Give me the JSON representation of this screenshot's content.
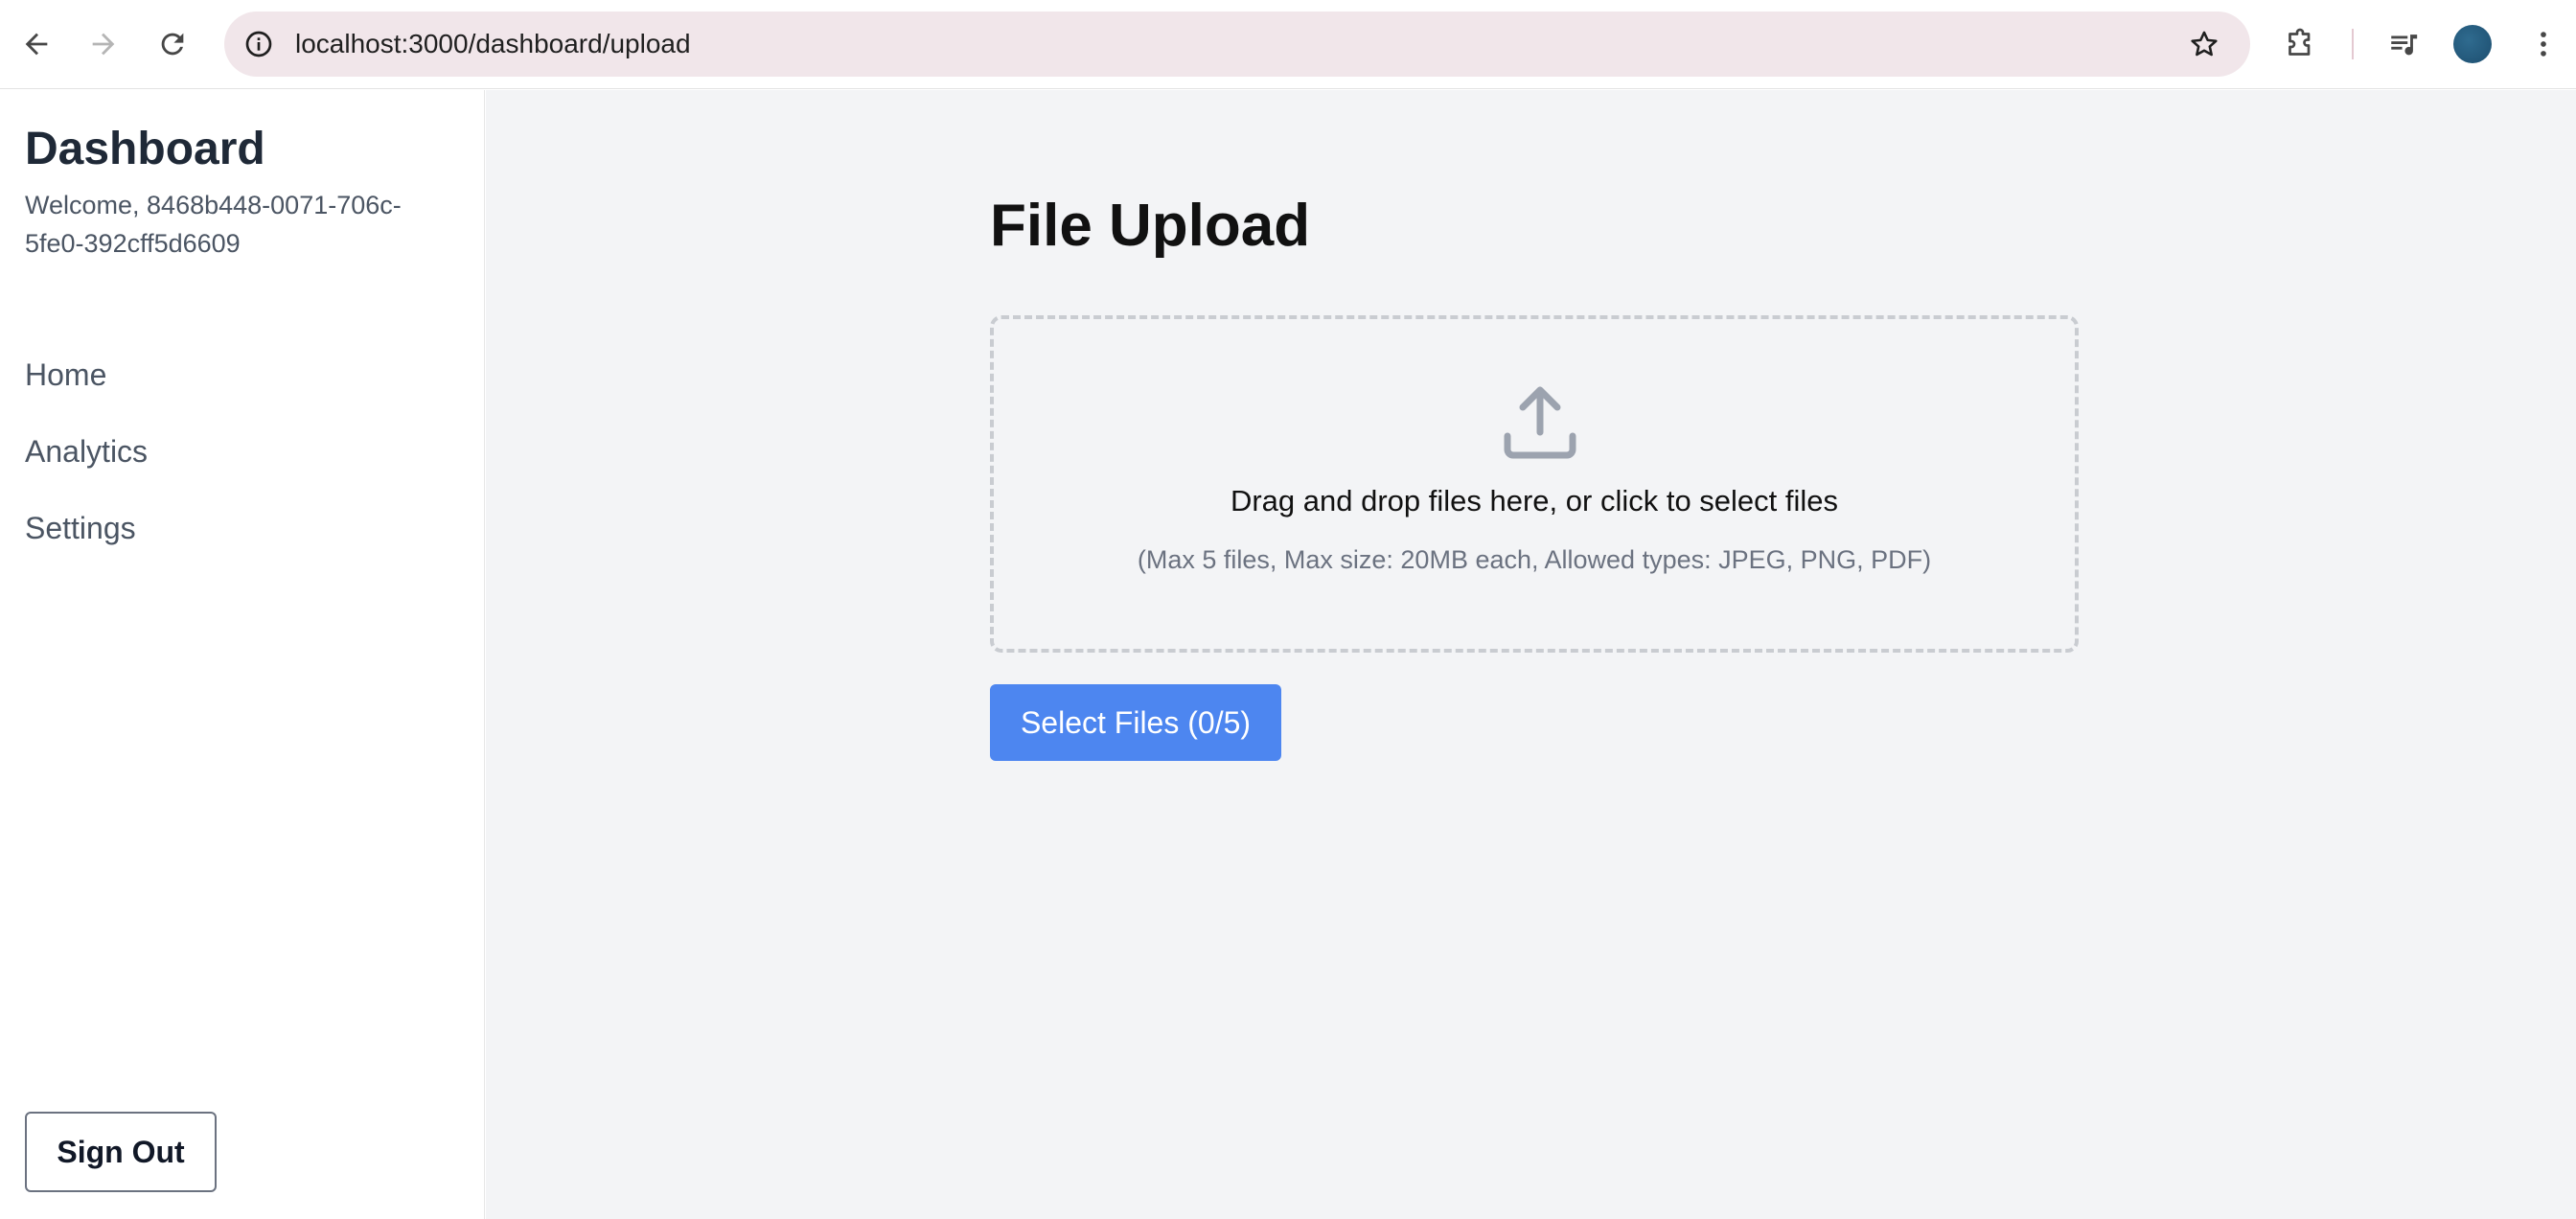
{
  "browser": {
    "url": "localhost:3000/dashboard/upload"
  },
  "sidebar": {
    "title": "Dashboard",
    "welcome": "Welcome, 8468b448-0071-706c-5fe0-392cff5d6609",
    "items": [
      {
        "label": "Home"
      },
      {
        "label": "Analytics"
      },
      {
        "label": "Settings"
      }
    ],
    "signout_label": "Sign Out"
  },
  "main": {
    "title": "File Upload",
    "dropzone": {
      "primary_text": "Drag and drop files here, or click to select files",
      "secondary_text": "(Max 5 files, Max size: 20MB each, Allowed types: JPEG, PNG, PDF)",
      "icon": "upload-icon"
    },
    "select_button_label": "Select Files (0/5)"
  },
  "colors": {
    "accent": "#4d86f0",
    "main_bg": "#f3f4f6",
    "omnibox_bg": "#f1e6ea"
  }
}
